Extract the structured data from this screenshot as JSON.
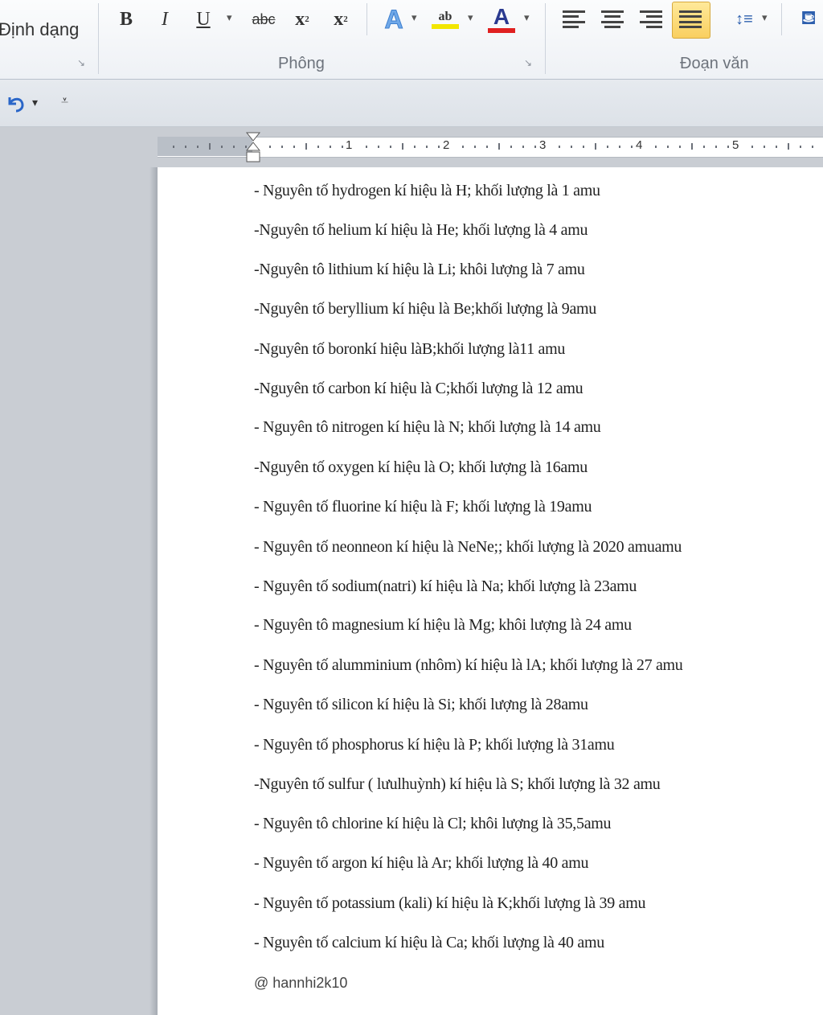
{
  "ribbon": {
    "style_group_label": "Định dạng",
    "font_group_label": "Phông",
    "paragraph_group_label": "Đoạn văn",
    "bold_label": "B",
    "italic_label": "I",
    "underline_label": "U",
    "strike_label": "abc",
    "subscript_label": "x",
    "superscript_label": "x",
    "font_color_label": "A",
    "text_effects_label": "A",
    "highlight_label": "ab",
    "accent_red": "#e02020",
    "highlight_yellow": "#f2e600",
    "active_fill": "#f9cf5f"
  },
  "ruler": {
    "numbers": [
      "1",
      "2",
      "3",
      "4",
      "5"
    ]
  },
  "document": {
    "lines": [
      "- Nguyên tố hydrogen kí hiệu là H; khối lượng là 1 amu",
      "-Nguyên tố helium kí hiệu là He; khối lượng là 4 amu",
      "-Nguyên tô lithium kí hiệu là Li; khôi lượng là 7 amu",
      "-Nguyên tố beryllium kí hiệu là Be;khối lượng là 9amu",
      "-Nguyên tố boronkí hiệu làB;khối lượng là11 amu",
      "-Nguyên tố carbon kí hiệu là C;khối lượng là 12 amu",
      "- Nguyên tô nitrogen kí hiệu là N; khối lượng là 14 amu",
      "-Nguyên tố oxygen kí hiệu là O; khối lượng là 16amu",
      "- Nguyên tố fluorine kí hiệu là F; khối lượng là 19amu",
      "- Nguyên tố neonneon kí hiệu là NeNe;; khối lượng là 2020 amuamu",
      "- Nguyên tố sodium(natri) kí hiệu là Na; khối lượng là 23amu",
      "- Nguyên tô magnesium kí hiệu là Mg; khôi lượng là 24 amu",
      "- Nguyên tố alumminium (nhôm) kí hiệu là lA; khối lượng là 27 amu",
      "- Nguyên tố silicon kí hiệu là Si; khối lượng là 28amu",
      "- Nguyên tố phosphorus kí hiệu là P; khối lượng là 31amu",
      "-Nguyên tố sulfur ( lưulhuỳnh) kí hiệu là S; khối lượng là 32 amu",
      "- Nguyên tô chlorine kí hiệu là Cl; khôi lượng là 35,5amu",
      "- Nguyên tố argon kí hiệu là Ar; khối lượng là 40 amu",
      "- Nguyên tố potassium (kali) kí hiệu là K;khối lượng là 39 amu",
      "- Nguyên tố calcium kí hiệu là Ca; khối lượng là 40 amu"
    ],
    "watermark": "@ hannhi2k10"
  }
}
